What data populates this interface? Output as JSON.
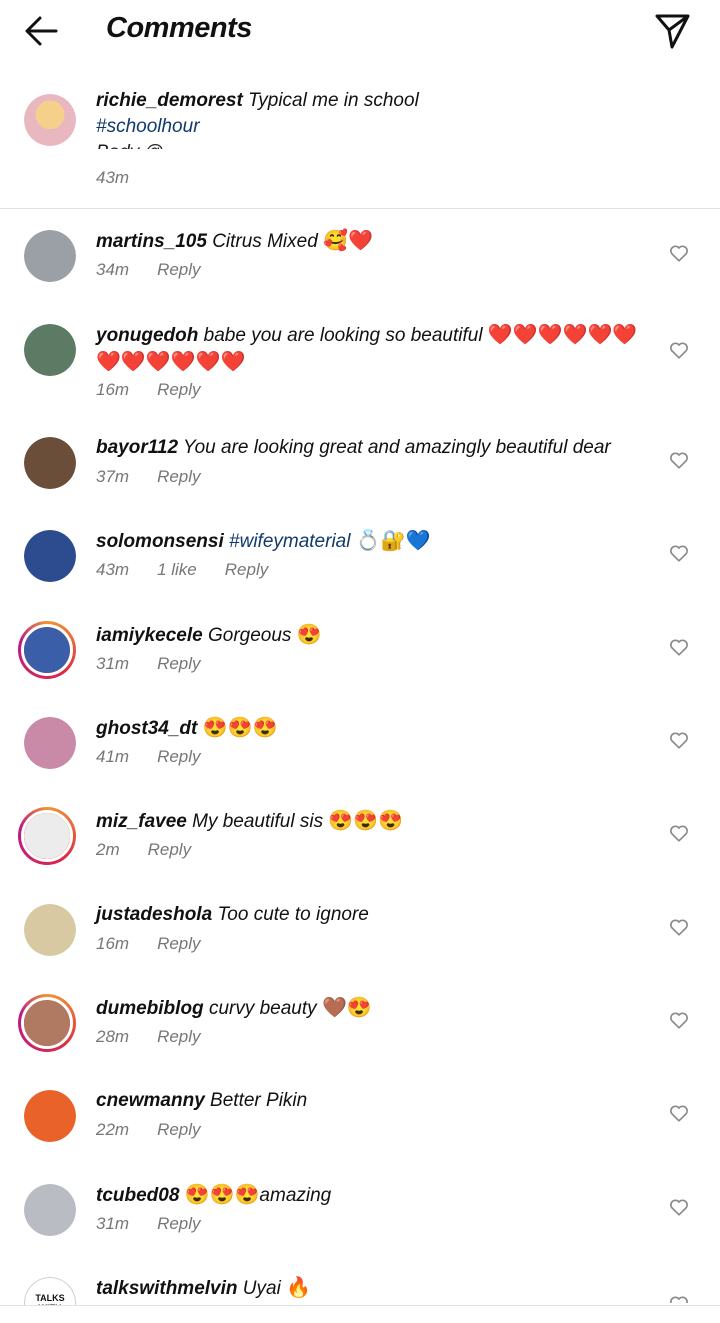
{
  "header": {
    "title": "Comments"
  },
  "caption": {
    "username": "richie_demorest",
    "text": "Typical me in school",
    "hashtag": "#schoolhour",
    "truncated": "Body @_ _ _ _ _ _ _ _ _ _",
    "time": "43m",
    "avatar_color": "#f2c46a"
  },
  "reply_label": "Reply",
  "comments": [
    {
      "username": "martins_105",
      "text": "Citrus Mixed",
      "emoji": "🥰❤️",
      "time": "34m",
      "likes": "",
      "avatar": "#9aa0a6",
      "story": false
    },
    {
      "username": "yonugedoh",
      "text": "babe you are looking so beautiful",
      "emoji": "❤️❤️❤️❤️❤️❤️",
      "emoji2": "❤️❤️❤️❤️❤️❤️",
      "time": "16m",
      "likes": "",
      "avatar": "#5c7a64",
      "story": false
    },
    {
      "username": "bayor112",
      "text": "You are looking great and amazingly beautiful dear",
      "emoji": "",
      "time": "37m",
      "likes": "",
      "avatar": "#6b4e3a",
      "story": false
    },
    {
      "username": "solomonsensi",
      "hashtag": "#wifeymaterial",
      "emoji": "💍🔐💙",
      "time": "43m",
      "likes": "1 like",
      "avatar": "#2d4b8f",
      "story": false
    },
    {
      "username": "iamiykecele",
      "text": "Gorgeous",
      "emoji": "😍",
      "time": "31m",
      "likes": "",
      "avatar": "#3a5fa8",
      "story": true
    },
    {
      "username": "ghost34_dt",
      "text": "",
      "emoji": "😍😍😍",
      "time": "41m",
      "likes": "",
      "avatar": "#c88aa6",
      "story": false
    },
    {
      "username": "miz_favee",
      "text": "My beautiful sis",
      "emoji": "😍😍😍",
      "time": "2m",
      "likes": "",
      "avatar": "#ececec",
      "story": true
    },
    {
      "username": "justadeshola",
      "text": "Too cute to ignore",
      "emoji": "",
      "time": "16m",
      "likes": "",
      "avatar": "#d9c9a3",
      "story": false
    },
    {
      "username": "dumebiblog",
      "text": "curvy beauty",
      "emoji": "🤎😍",
      "time": "28m",
      "likes": "",
      "avatar": "#b07a62",
      "story": true
    },
    {
      "username": "cnewmanny",
      "text": "Better Pikin",
      "emoji": "",
      "time": "22m",
      "likes": "",
      "avatar": "#e8622a",
      "story": false
    },
    {
      "username": "tcubed08",
      "text": "amazing",
      "emoji_before": "😍😍😍",
      "time": "31m",
      "likes": "",
      "avatar": "#b9bcc2",
      "story": false
    },
    {
      "username": "talkswithmelvin",
      "text": "Uyai",
      "emoji": "🔥",
      "time": "",
      "likes": "",
      "avatar": "#ffffff",
      "avatar_text": "TALKS WITH",
      "story": false
    }
  ]
}
